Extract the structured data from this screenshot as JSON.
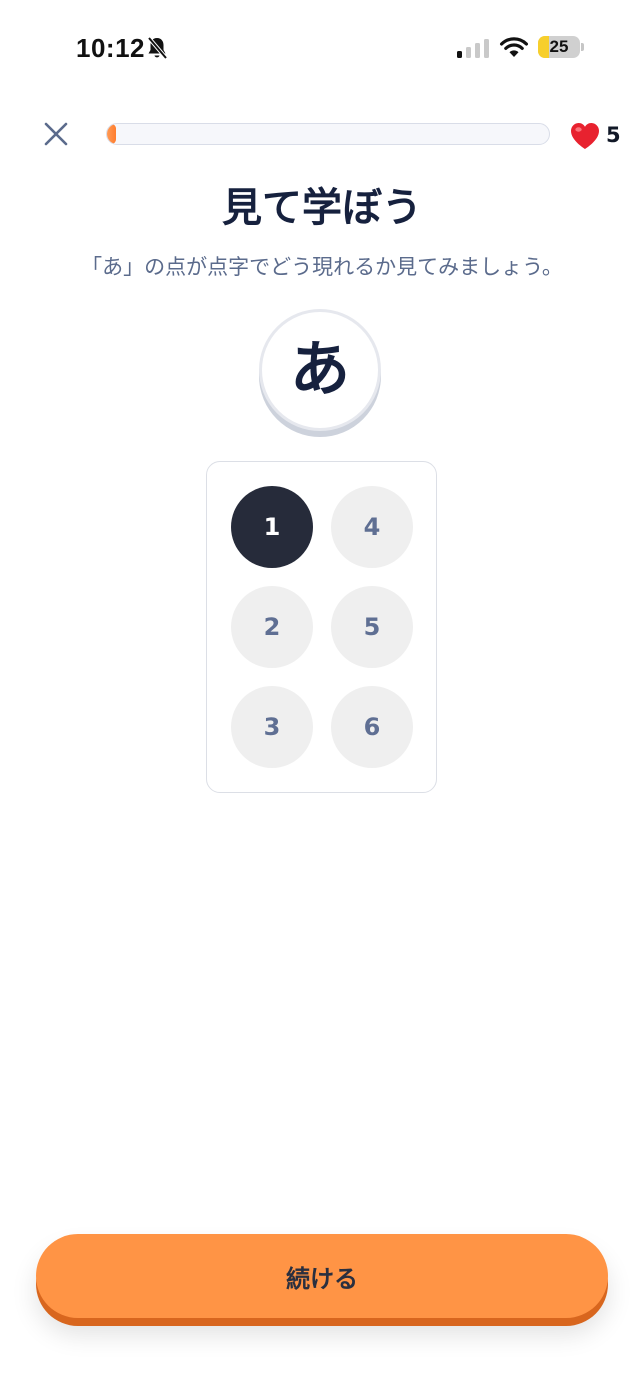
{
  "status_bar": {
    "time": "10:12",
    "battery_level": "25",
    "battery_fraction": 0.25,
    "icons": [
      "bell-muted-icon",
      "signal-icon",
      "wifi-icon",
      "battery-icon"
    ]
  },
  "header": {
    "close_icon": "close-icon",
    "progress_fraction": 0.02,
    "lives": "5",
    "lives_icon": "heart-icon"
  },
  "lesson": {
    "title": "見て学ぼう",
    "subtitle": "「あ」の点が点字でどう現れるか見てみましょう。",
    "character": "あ"
  },
  "braille": {
    "dots": [
      {
        "number": "1",
        "raised": true
      },
      {
        "number": "2",
        "raised": false
      },
      {
        "number": "3",
        "raised": false
      },
      {
        "number": "4",
        "raised": false
      },
      {
        "number": "5",
        "raised": false
      },
      {
        "number": "6",
        "raised": false
      }
    ]
  },
  "footer": {
    "continue_label": "続ける"
  },
  "colors": {
    "accent": "#ff9445",
    "accent_shadow": "#d8661e",
    "raised_dot": "#262b3a",
    "flat_dot": "#efefef",
    "text_primary": "#16213e",
    "text_secondary": "#5b6b8c"
  }
}
